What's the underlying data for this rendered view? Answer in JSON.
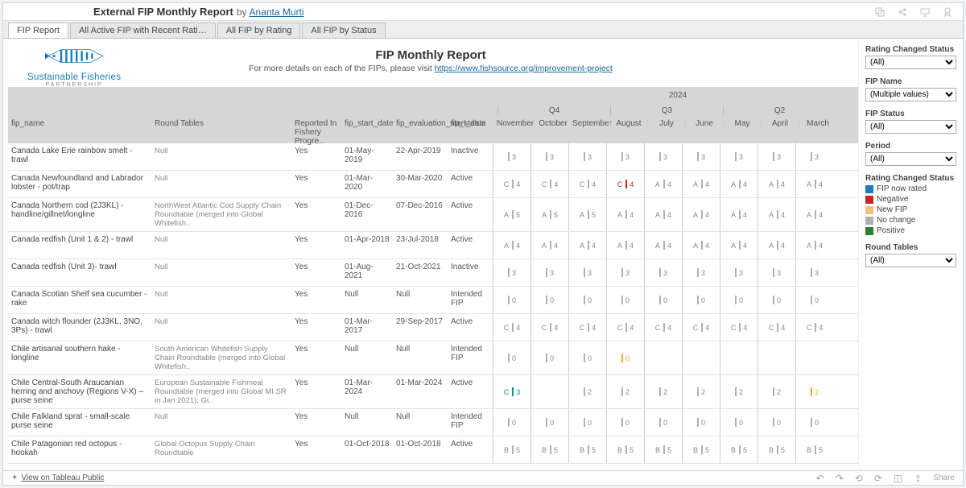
{
  "header": {
    "title": "External FIP Monthly Report",
    "by": "by",
    "author": "Ananta Murti"
  },
  "tabs": [
    "FIP Report",
    "All Active FIP with Recent Rati…",
    "All FIP by Rating",
    "All FIP by Status"
  ],
  "active_tab": 0,
  "logo": {
    "line1": "Sustainable Fisheries",
    "line2": "PARTNERSHIP"
  },
  "report": {
    "title": "FIP Monthly Report",
    "subtitle_prefix": "For more details on each of the FIPs, please visit ",
    "link": "https://www.fishsource.org/improvement-project"
  },
  "year": "2024",
  "quarters": [
    "Q4",
    "Q3",
    "Q2"
  ],
  "cols": {
    "name": "fip_name",
    "rt": "Round Tables",
    "rep": "Reported In Fishery Progre..",
    "st": "fip_start_date",
    "ev": "fip_evaluation_start_date",
    "fst": "fip_status"
  },
  "months": [
    "November",
    "October",
    "September",
    "August",
    "July",
    "June",
    "May",
    "April",
    "March"
  ],
  "rows": [
    {
      "name": "Canada Lake Erie rainbow smelt - trawl",
      "rt": "Null",
      "rep": "Yes",
      "st": "01-May-2019",
      "ev": "22-Apr-2019",
      "fst": "Inactive",
      "cells": [
        {
          "v": "3"
        },
        {
          "v": "3"
        },
        {
          "v": "3"
        },
        {
          "v": "3"
        },
        {
          "v": "3"
        },
        {
          "v": "3"
        },
        {
          "v": "3"
        },
        {
          "v": "3"
        },
        {
          "v": "3"
        }
      ]
    },
    {
      "name": "Canada Newfoundland and Labrador lobster - pot/trap",
      "rt": "Null",
      "rep": "Yes",
      "st": "01-Mar-2020",
      "ev": "30-Mar-2020",
      "fst": "Active",
      "cells": [
        {
          "l": "C",
          "v": "4"
        },
        {
          "l": "C",
          "v": "4"
        },
        {
          "l": "C",
          "v": "4"
        },
        {
          "l": "C",
          "v": "4",
          "c": "r"
        },
        {
          "l": "A",
          "v": "4"
        },
        {
          "l": "A",
          "v": "4"
        },
        {
          "l": "A",
          "v": "4"
        },
        {
          "l": "A",
          "v": "4"
        },
        {
          "l": "A",
          "v": "4"
        }
      ]
    },
    {
      "name": "Canada Northern cod (2J3KL) - handline/gillnet/longline",
      "rt": "NorthWest Atlantic Cod Supply Chain Roundtable (merged into Global Whitefish..",
      "rep": "Yes",
      "st": "01-Dec-2016",
      "ev": "07-Dec-2016",
      "fst": "Active",
      "cells": [
        {
          "l": "A",
          "v": "5"
        },
        {
          "l": "A",
          "v": "5"
        },
        {
          "l": "A",
          "v": "5"
        },
        {
          "l": "A",
          "v": "4"
        },
        {
          "l": "A",
          "v": "4"
        },
        {
          "l": "A",
          "v": "4"
        },
        {
          "l": "A",
          "v": "4"
        },
        {
          "l": "A",
          "v": "4"
        },
        {
          "l": "A",
          "v": "4"
        }
      ]
    },
    {
      "name": "Canada redfish (Unit 1 & 2) - trawl",
      "rt": "Null",
      "rep": "Yes",
      "st": "01-Apr-2018",
      "ev": "23-Jul-2018",
      "fst": "Active",
      "cells": [
        {
          "l": "A",
          "v": "4"
        },
        {
          "l": "A",
          "v": "4"
        },
        {
          "l": "A",
          "v": "4"
        },
        {
          "l": "A",
          "v": "4"
        },
        {
          "l": "A",
          "v": "4"
        },
        {
          "l": "A",
          "v": "4"
        },
        {
          "l": "A",
          "v": "4"
        },
        {
          "l": "A",
          "v": "4"
        },
        {
          "l": "A",
          "v": "4"
        }
      ]
    },
    {
      "name": "Canada redfish (Unit 3)- trawl",
      "rt": "Null",
      "rep": "Yes",
      "st": "01-Aug-2021",
      "ev": "21-Oct-2021",
      "fst": "Inactive",
      "cells": [
        {
          "v": "3"
        },
        {
          "v": "3"
        },
        {
          "v": "3"
        },
        {
          "v": "3"
        },
        {
          "v": "3"
        },
        {
          "v": "3"
        },
        {
          "v": "3"
        },
        {
          "v": "3"
        },
        {
          "v": "3"
        }
      ]
    },
    {
      "name": "Canada Scotian Shelf sea cucumber - rake",
      "rt": "Null",
      "rep": "Yes",
      "st": "Null",
      "ev": "Null",
      "fst": "Intended FIP",
      "cells": [
        {
          "v": "0"
        },
        {
          "v": "0"
        },
        {
          "v": "0"
        },
        {
          "v": "0"
        },
        {
          "v": "0"
        },
        {
          "v": "0"
        },
        {
          "v": "0"
        },
        {
          "v": "0"
        },
        {
          "v": "0"
        }
      ]
    },
    {
      "name": "Canada witch flounder (2J3KL, 3NO, 3Ps) - trawl",
      "rt": "Null",
      "rep": "Yes",
      "st": "01-Mar-2017",
      "ev": "29-Sep-2017",
      "fst": "Active",
      "cells": [
        {
          "l": "C",
          "v": "4"
        },
        {
          "l": "C",
          "v": "4"
        },
        {
          "l": "C",
          "v": "4"
        },
        {
          "l": "C",
          "v": "4"
        },
        {
          "l": "C",
          "v": "4"
        },
        {
          "l": "C",
          "v": "4"
        },
        {
          "l": "C",
          "v": "4"
        },
        {
          "l": "C",
          "v": "4"
        },
        {
          "l": "C",
          "v": "4"
        }
      ]
    },
    {
      "name": "Chile artisanal southern hake - longline",
      "rt": "South American Whitefish Supply Chain Roundtable (merged into Global Whitefish..",
      "rep": "Yes",
      "st": "Null",
      "ev": "Null",
      "fst": "Intended FIP",
      "cells": [
        {
          "v": "0"
        },
        {
          "v": "0"
        },
        {
          "v": "0"
        },
        {
          "v": "0",
          "c": "o"
        },
        {},
        {},
        {},
        {},
        {}
      ]
    },
    {
      "name": "Chile Central-South Araucanian herring and anchovy (Regions V-X) – purse seine",
      "rt": "European Sustainable Fishmeal Roundtable (merged into Global MI SR in Jan 2021); Gl..",
      "rep": "Yes",
      "st": "01-Mar-2024",
      "ev": "01-Mar-2024",
      "fst": "Active",
      "cells": [
        {
          "l": "C",
          "v": "3",
          "c": "t"
        },
        {},
        {
          "v": "2"
        },
        {
          "v": "2"
        },
        {
          "v": "2"
        },
        {
          "v": "2"
        },
        {
          "v": "2"
        },
        {
          "v": "2"
        },
        {
          "v": "2",
          "c": "o"
        }
      ]
    },
    {
      "name": "Chile Falkland sprat - small-scale purse seine",
      "rt": "Null",
      "rep": "Yes",
      "st": "Null",
      "ev": "Null",
      "fst": "Intended FIP",
      "cells": [
        {
          "v": "0"
        },
        {
          "v": "0"
        },
        {
          "v": "0"
        },
        {
          "v": "0"
        },
        {
          "v": "0"
        },
        {
          "v": "0"
        },
        {
          "v": "0"
        },
        {
          "v": "0"
        },
        {
          "v": "0"
        }
      ]
    },
    {
      "name": "Chile Patagonian red octopus - hookah",
      "rt": "Global Octopus Supply Chain Roundtable",
      "rep": "Yes",
      "st": "01-Oct-2018",
      "ev": "01-Oct-2018",
      "fst": "Active",
      "cells": [
        {
          "l": "B",
          "v": "5"
        },
        {
          "l": "B",
          "v": "5"
        },
        {
          "l": "B",
          "v": "5"
        },
        {
          "l": "B",
          "v": "5"
        },
        {
          "l": "B",
          "v": "5"
        },
        {
          "l": "B",
          "v": "5"
        },
        {
          "l": "B",
          "v": "5"
        },
        {
          "l": "B",
          "v": "5"
        },
        {
          "l": "B",
          "v": "5"
        }
      ]
    }
  ],
  "side": {
    "rcs": {
      "label": "Rating Changed Status",
      "value": "(All)"
    },
    "fipname": {
      "label": "FIP Name",
      "value": "(Multiple values)"
    },
    "fipstatus": {
      "label": "FIP Status",
      "value": "(All)"
    },
    "period": {
      "label": "Period",
      "value": "(All)"
    },
    "legend_label": "Rating Changed Status",
    "legend": [
      {
        "c": "#1c7db6",
        "t": "FIP now rated"
      },
      {
        "c": "#c62828",
        "t": "Negative"
      },
      {
        "c": "#f4c17a",
        "t": "New FIP"
      },
      {
        "c": "#b0b0b0",
        "t": "No change"
      },
      {
        "c": "#2e7d32",
        "t": "Positive"
      }
    ],
    "rt": {
      "label": "Round Tables",
      "value": "(All)"
    }
  },
  "footer": {
    "view": "View on Tableau Public",
    "share": "Share"
  }
}
